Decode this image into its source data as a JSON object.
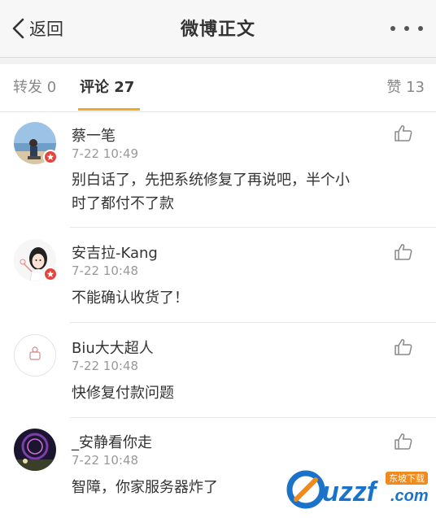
{
  "nav": {
    "back_label": "返回",
    "title": "微博正文",
    "more_icon": "more-dots-icon"
  },
  "tabs": {
    "repost": "转发 0",
    "comment": "评论 27",
    "like": "赞 13",
    "active": "comment",
    "accent_color": "#f5a623"
  },
  "comments": [
    {
      "username": "蔡一笔",
      "time": "7-22 10:49",
      "text_line1": "别白话了，先把系统修复了再说吧，半个小",
      "text_line2": "时了都付不了款",
      "verified": true
    },
    {
      "username": "安吉拉-Kang",
      "time": "7-22 10:48",
      "text_line1": "不能确认收货了！",
      "verified": true
    },
    {
      "username": "Biu大大超人",
      "time": "7-22 10:48",
      "text_line1": "快修复付款问题",
      "verified": false
    },
    {
      "username": "_安静看你走",
      "time": "7-22 10:48",
      "text_line1": "智障，你家服务器炸了",
      "verified": false
    }
  ],
  "colors": {
    "badge": "#e8433b",
    "watermark_blue": "#1a73c9",
    "watermark_orange": "#f08a1c"
  }
}
